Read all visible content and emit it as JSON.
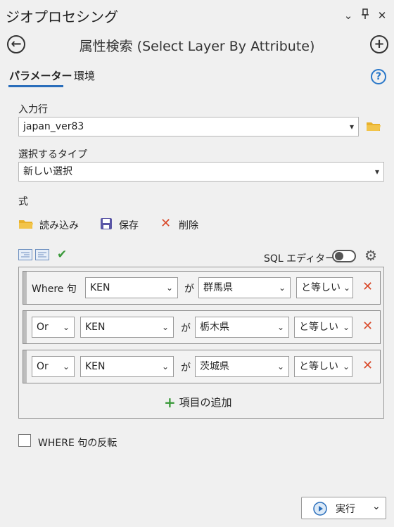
{
  "pane": {
    "title": "ジオプロセシング"
  },
  "tool": {
    "title": "属性検索 (Select Layer By Attribute)"
  },
  "tabs": [
    {
      "label": "パラメーター"
    },
    {
      "label": "環境"
    }
  ],
  "params": {
    "input_rows_label": "入力行",
    "input_rows_value": "japan_ver83",
    "selection_type_label": "選択するタイプ",
    "selection_type_value": "新しい選択",
    "expression_label": "式"
  },
  "expr_toolbar": {
    "load": "読み込み",
    "save": "保存",
    "delete": "削除"
  },
  "sql_editor": {
    "label": "SQL エディター"
  },
  "clauses": [
    {
      "connector": "Where 句",
      "field": "KEN",
      "ga": "が",
      "value": "群馬県",
      "operator": "と等しい"
    },
    {
      "connector": "Or",
      "field": "KEN",
      "ga": "が",
      "value": "栃木県",
      "operator": "と等しい"
    },
    {
      "connector": "Or",
      "field": "KEN",
      "ga": "が",
      "value": "茨城県",
      "operator": "と等しい"
    }
  ],
  "add_clause": {
    "label": "項目の追加"
  },
  "invert": {
    "label": "WHERE 句の反転",
    "checked": false
  },
  "run": {
    "label": "実行"
  },
  "colors": {
    "accent": "#2a6ebb",
    "delete": "#d94a2b",
    "add": "#3b9a3b",
    "folder": "#e8b12b"
  }
}
